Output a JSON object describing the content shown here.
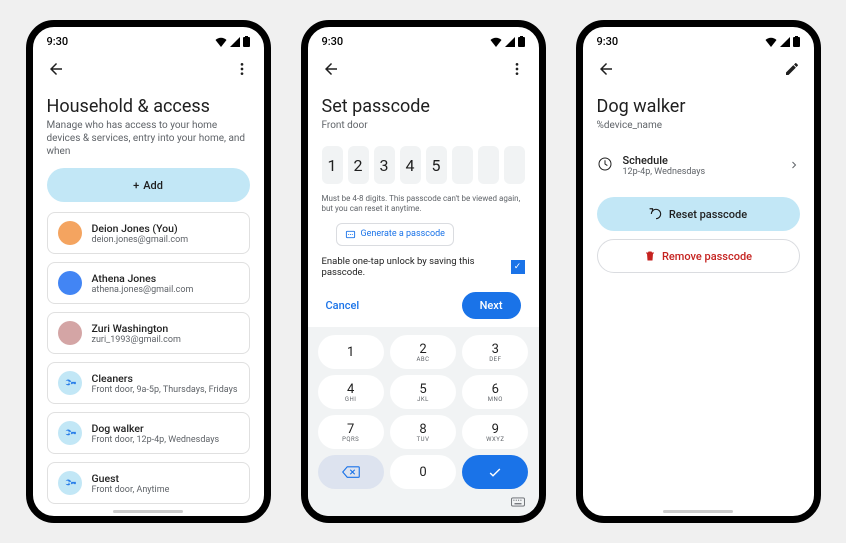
{
  "status_time": "9:30",
  "screen1": {
    "title": "Household & access",
    "subtitle": "Manage who has access to your home devices & services, entry into your home, and when",
    "add_label": "Add",
    "people": [
      {
        "name": "Deion Jones (You)",
        "email": "deion.jones@gmail.com"
      },
      {
        "name": "Athena Jones",
        "email": "athena.jones@gmail.com"
      },
      {
        "name": "Zuri Washington",
        "email": "zuri_1993@gmail.com"
      }
    ],
    "access": [
      {
        "name": "Cleaners",
        "detail": "Front door, 9a-5p, Thursdays, Fridays"
      },
      {
        "name": "Dog walker",
        "detail": "Front door, 12p-4p, Wednesdays"
      },
      {
        "name": "Guest",
        "detail": "Front door, Anytime"
      }
    ]
  },
  "screen2": {
    "title": "Set passcode",
    "subtitle": "Front door",
    "digits": [
      "1",
      "2",
      "3",
      "4",
      "5",
      "",
      "",
      ""
    ],
    "hint": "Must be 4-8 digits. This passcode can't be viewed again, but you can reset it anytime.",
    "generate_label": "Generate a passcode",
    "enable_label": "Enable one-tap unlock by saving this passcode.",
    "checked": true,
    "cancel_label": "Cancel",
    "next_label": "Next",
    "keypad": [
      [
        {
          "n": "1",
          "s": ""
        },
        {
          "n": "2",
          "s": "ABC"
        },
        {
          "n": "3",
          "s": "DEF"
        }
      ],
      [
        {
          "n": "4",
          "s": "GHI"
        },
        {
          "n": "5",
          "s": "JKL"
        },
        {
          "n": "6",
          "s": "MNO"
        }
      ],
      [
        {
          "n": "7",
          "s": "PQRS"
        },
        {
          "n": "8",
          "s": "TUV"
        },
        {
          "n": "9",
          "s": "WXYZ"
        }
      ]
    ],
    "key0": "0"
  },
  "screen3": {
    "title": "Dog walker",
    "subtitle": "%device_name",
    "schedule_label": "Schedule",
    "schedule_detail": "12p-4p, Wednesdays",
    "reset_label": "Reset passcode",
    "remove_label": "Remove passcode"
  }
}
